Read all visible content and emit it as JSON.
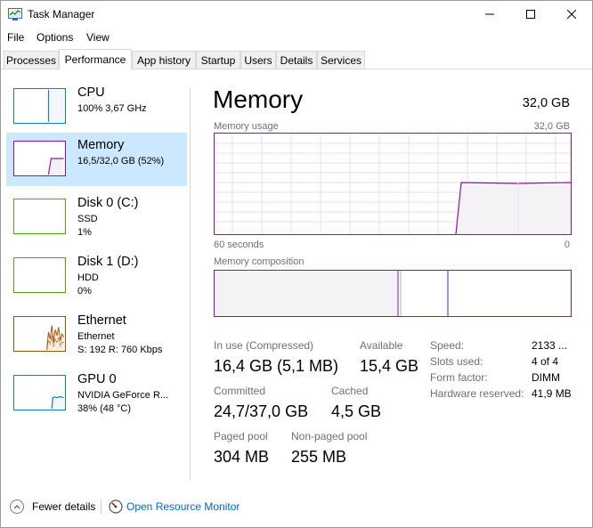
{
  "window": {
    "title": "Task Manager"
  },
  "menu": [
    "File",
    "Options",
    "View"
  ],
  "tabs": [
    "Processes",
    "Performance",
    "App history",
    "Startup",
    "Users",
    "Details",
    "Services"
  ],
  "perf_items": [
    {
      "name": "CPU",
      "line1": "100%  3,67 GHz",
      "line2": "",
      "line3": ""
    },
    {
      "name": "Memory",
      "line1": "16,5/32,0 GB (52%)",
      "line2": "",
      "line3": ""
    },
    {
      "name": "Disk 0 (C:)",
      "line1": "SSD",
      "line2": "1%",
      "line3": ""
    },
    {
      "name": "Disk 1 (D:)",
      "line1": "HDD",
      "line2": "0%",
      "line3": ""
    },
    {
      "name": "Ethernet",
      "line1": "Ethernet",
      "line2": "S: 192  R: 760 Kbps",
      "line3": ""
    },
    {
      "name": "GPU 0",
      "line1": "NVIDIA GeForce R...",
      "line2": "38%  (48 °C)",
      "line3": ""
    }
  ],
  "detail": {
    "title": "Memory",
    "total": "32,0 GB",
    "usage_label": "Memory usage",
    "usage_max": "32,0 GB",
    "x_left": "60 seconds",
    "x_right": "0",
    "composition_label": "Memory composition",
    "usage_level": 0.52,
    "stats": {
      "in_use_label": "In use (Compressed)",
      "in_use_value": "16,4 GB (5,1 MB)",
      "available_label": "Available",
      "available_value": "15,4 GB",
      "committed_label": "Committed",
      "committed_value": "24,7/37,0 GB",
      "cached_label": "Cached",
      "cached_value": "4,5 GB",
      "paged_label": "Paged pool",
      "paged_value": "304 MB",
      "nonpaged_label": "Non-paged pool",
      "nonpaged_value": "255 MB"
    },
    "info": [
      {
        "label": "Speed:",
        "value": "2133 ..."
      },
      {
        "label": "Slots used:",
        "value": "4 of 4"
      },
      {
        "label": "Form factor:",
        "value": "DIMM"
      },
      {
        "label": "Hardware reserved:",
        "value": "41,9 MB"
      }
    ]
  },
  "footer": {
    "fewer_details": "Fewer details",
    "open_monitor": "Open Resource Monitor"
  },
  "colors": {
    "memory": "#8b12ae",
    "cpu": "#117dbb",
    "disk": "#4da60c",
    "ethernet": "#a74f01",
    "gpu": "#117dbb",
    "selected_bg": "#cce8ff",
    "link": "#0066cc"
  },
  "icons": {
    "app": "task-manager-icon",
    "fewer": "chevron-up-icon",
    "monitor": "resource-monitor-icon"
  }
}
